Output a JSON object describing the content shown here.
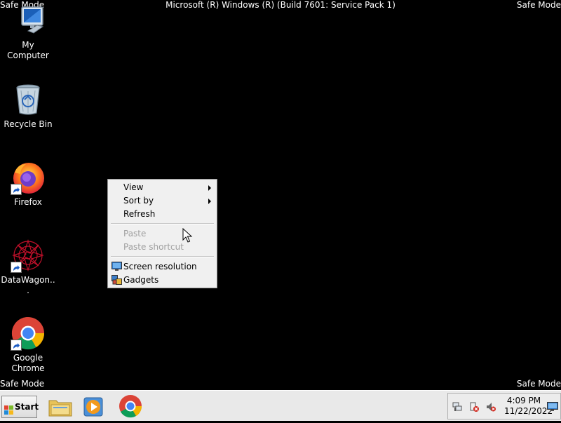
{
  "safe_mode": {
    "top_left": "Safe Mode",
    "top_right": "Safe Mode",
    "bottom_left": "Safe Mode",
    "bottom_right": "Safe Mode"
  },
  "build_title": "Microsoft (R) Windows (R) (Build 7601: Service Pack 1)",
  "desktop_icons": [
    {
      "label": "My Computer",
      "icon": "computer-icon"
    },
    {
      "label": "Recycle Bin",
      "icon": "recycle-bin-icon"
    },
    {
      "label": "Firefox",
      "icon": "firefox-icon"
    },
    {
      "label": "DataWagon...",
      "icon": "datawagon-icon"
    },
    {
      "label": "Google Chrome",
      "icon": "chrome-icon"
    }
  ],
  "context_menu": {
    "items": [
      {
        "label": "View",
        "submenu": true,
        "enabled": true
      },
      {
        "label": "Sort by",
        "submenu": true,
        "enabled": true
      },
      {
        "label": "Refresh",
        "submenu": false,
        "enabled": true
      },
      {
        "label": "Paste",
        "submenu": false,
        "enabled": false
      },
      {
        "label": "Paste shortcut",
        "submenu": false,
        "enabled": false
      },
      {
        "label": "Screen resolution",
        "submenu": false,
        "enabled": true,
        "icon": "screen-resolution-icon"
      },
      {
        "label": "Gadgets",
        "submenu": false,
        "enabled": true,
        "icon": "gadgets-icon"
      }
    ]
  },
  "taskbar": {
    "start_label": "Start",
    "pinned": [
      "explorer-icon",
      "media-player-icon",
      "chrome-icon"
    ],
    "tray_icons": [
      "network-icon",
      "action-center-icon",
      "volume-muted-icon"
    ],
    "clock_time": "4:09 PM",
    "clock_date": "11/22/2022"
  }
}
